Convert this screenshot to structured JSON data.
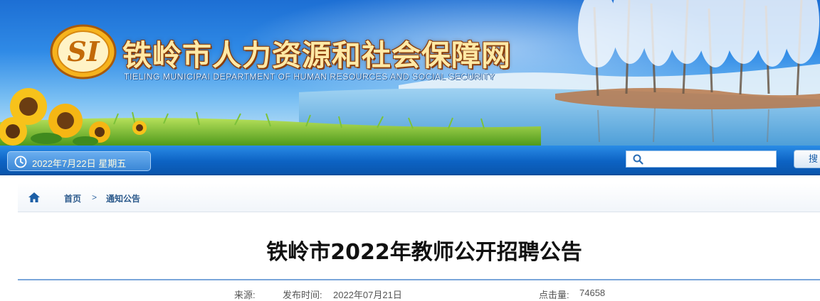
{
  "header": {
    "site_title": "铁岭市人力资源和社会保障网",
    "site_subtitle": "TIELING MUNICIPAI DEPARTMENT OF HUMAN RESOURCES AND SOCIAL SECURITY",
    "logo_text": "SI"
  },
  "navbar": {
    "date": "2022年7月22日 星期五",
    "search_placeholder": "",
    "search_button": "搜"
  },
  "breadcrumb": {
    "items": [
      {
        "label": "首页"
      },
      {
        "label": ">"
      },
      {
        "label": "通知公告"
      }
    ]
  },
  "article": {
    "title": "铁岭市2022年教师公开招聘公告",
    "source_label": "来源:",
    "publish_time_label": "发布时间:",
    "publish_time": "2022年07月21日",
    "views_label": "点击量:",
    "views": "74658"
  },
  "colors": {
    "nav_blue": "#0d63c4",
    "link_blue": "#2c5a8c",
    "title_gold": "#ffe9a6"
  }
}
